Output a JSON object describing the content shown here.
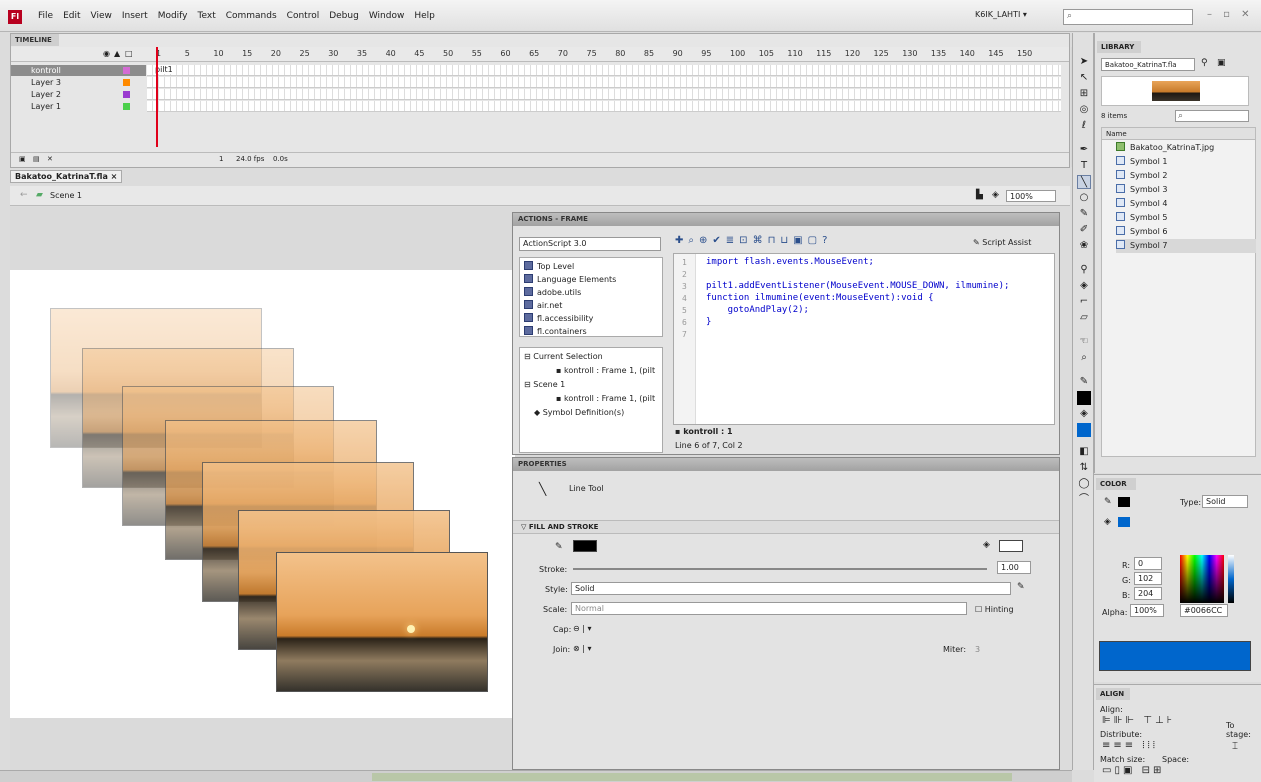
{
  "app": {
    "logo_text": "Fl",
    "menu": [
      "File",
      "Edit",
      "View",
      "Insert",
      "Modify",
      "Text",
      "Commands",
      "Control",
      "Debug",
      "Window",
      "Help"
    ],
    "workspace": "K6IK_LAHTI",
    "search_placeholder": ""
  },
  "timeline": {
    "title": "TIMELINE",
    "frame_numbers": [
      "1",
      "5",
      "10",
      "15",
      "20",
      "25",
      "30",
      "35",
      "40",
      "45",
      "50",
      "55",
      "60",
      "65",
      "70",
      "75",
      "80",
      "85",
      "90",
      "95",
      "100",
      "105",
      "110",
      "115",
      "120",
      "125",
      "130",
      "135",
      "140",
      "145",
      "150"
    ],
    "layers": [
      {
        "name": "kontroll",
        "color": "#d46bd4",
        "frame_label": "pilt1",
        "selected": true
      },
      {
        "name": "Layer 3",
        "color": "#ff8a00",
        "frame_label": "",
        "selected": false
      },
      {
        "name": "Layer 2",
        "color": "#9b3bd0",
        "frame_label": "",
        "selected": false
      },
      {
        "name": "Layer 1",
        "color": "#4cd04c",
        "frame_label": "",
        "selected": false
      }
    ],
    "current_frame": "1",
    "fps": "24.0 fps",
    "time": "0.0s"
  },
  "document": {
    "tab": "Bakatoo_KatrinaT.fla",
    "scene": "Scene 1",
    "zoom": "100%"
  },
  "actions": {
    "title": "ACTIONS - FRAME",
    "version": "ActionScript 3.0",
    "toolbox": [
      "Top Level",
      "Language Elements",
      "adobe.utils",
      "air.net",
      "fl.accessibility",
      "fl.containers"
    ],
    "tree": {
      "current_selection": "Current Selection",
      "current_frame": "kontroll : Frame 1, (pilt",
      "scene": "Scene 1",
      "scene_frame": "kontroll : Frame 1, (pilt",
      "symbol_defs": "Symbol Definition(s)"
    },
    "script_assist": "Script Assist",
    "line_numbers": [
      "1",
      "2",
      "3",
      "4",
      "5",
      "6",
      "7"
    ],
    "code": [
      "import flash.events.MouseEvent;",
      "",
      "pilt1.addEventListener(MouseEvent.MOUSE_DOWN, ilmumine);",
      "function ilmumine(event:MouseEvent):void {",
      "    gotoAndPlay(2);",
      "}",
      ""
    ],
    "script_tab": "kontroll : 1",
    "status": "Line 6 of 7, Col 2"
  },
  "properties": {
    "title": "PROPERTIES",
    "tool": "Line Tool",
    "fill_stroke": "FILL AND STROKE",
    "stroke_label": "Stroke:",
    "stroke_value": "1.00",
    "style_label": "Style:",
    "style_value": "Solid",
    "scale_label": "Scale:",
    "scale_value": "Normal",
    "hinting_label": "Hinting",
    "cap_label": "Cap:",
    "join_label": "Join:",
    "miter_label": "Miter:",
    "miter_value": "3"
  },
  "library": {
    "title": "LIBRARY",
    "doc": "Bakatoo_KatrinaT.fla",
    "count": "8 items",
    "column": "Name",
    "items": [
      "Bakatoo_KatrinaT.jpg",
      "Symbol 1",
      "Symbol 2",
      "Symbol 3",
      "Symbol 4",
      "Symbol 5",
      "Symbol 6",
      "Symbol 7"
    ]
  },
  "color": {
    "title": "COLOR",
    "type_label": "Type:",
    "type_value": "Solid",
    "r_label": "R:",
    "r": "0",
    "g_label": "G:",
    "g": "102",
    "b_label": "B:",
    "b": "204",
    "alpha_label": "Alpha:",
    "alpha": "100%",
    "hex": "#0066CC",
    "swatch": "#0066CC"
  },
  "align": {
    "title": "ALIGN",
    "align_label": "Align:",
    "distribute_label": "Distribute:",
    "match_size_label": "Match size:",
    "space_label": "Space:",
    "to_stage_label": "To stage:"
  }
}
